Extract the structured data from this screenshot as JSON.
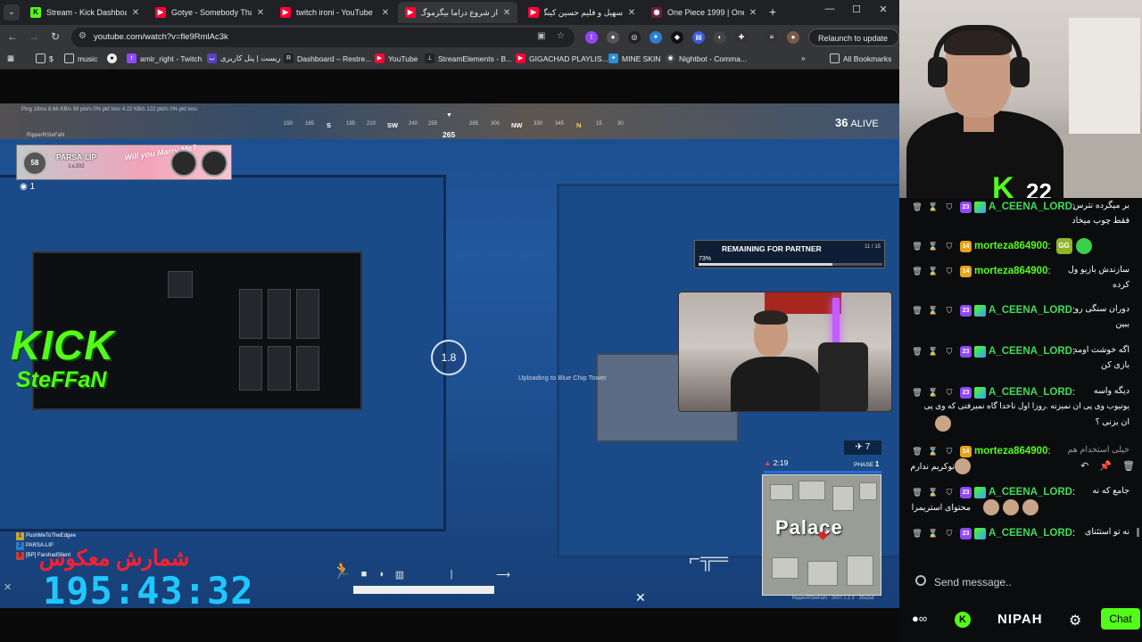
{
  "browser": {
    "tabs": [
      {
        "title": "Stream - Kick Dashboard",
        "color": "#53fc18",
        "fav": "K"
      },
      {
        "title": "Gotye - Somebody That I",
        "color": "#ff0033",
        "fav": "▶"
      },
      {
        "title": "twitch ironi - YouTube",
        "color": "#ff0033",
        "fav": "▶"
      },
      {
        "title": "از شروع دراما بیگزموگ",
        "color": "#ff0033",
        "fav": "▶"
      },
      {
        "title": "سهیل و فلیم حسین کینگ",
        "color": "#ff0033",
        "fav": "▶"
      },
      {
        "title": "One Piece 1999 | One Pie",
        "color": "#6b2130",
        "fav": "◉"
      }
    ],
    "new_tab": "+",
    "window_controls": {
      "minimize": "—",
      "maximize": "☐",
      "close": "✕"
    },
    "url": "youtube.com/watch?v=fle9RmlAc3k",
    "relaunch_label": "Relaunch to update",
    "bookmarks": [
      {
        "label": "$",
        "icon": "folder-icon"
      },
      {
        "label": "music",
        "icon": "folder-icon"
      },
      {
        "label": "",
        "icon": "github-icon"
      },
      {
        "label": "amir_right - Twitch",
        "icon": "twitch-icon"
      },
      {
        "label": "ریست | پنل کاربری",
        "icon": "panel-icon"
      },
      {
        "label": "Dashboard – Restre...",
        "icon": "restream-icon"
      },
      {
        "label": "YouTube",
        "icon": "youtube-icon"
      },
      {
        "label": "StreamElements - B...",
        "icon": "streamelements-icon"
      },
      {
        "label": "GIGACHAD PLAYLIS...",
        "icon": "youtube-icon"
      },
      {
        "label": "MINE SKIN",
        "icon": "mineskin-icon"
      },
      {
        "label": "Nightbot - Comma...",
        "icon": "nightbot-icon"
      }
    ],
    "more_bookmarks": "»",
    "all_bookmarks": "All Bookmarks"
  },
  "game": {
    "telemetry": "Ping 18ms    8.66 KB/s    59 pkt/s    0% pkt loss    4.22 KB/s    122 pkt/s    0% pkt loss",
    "compass": {
      "ticks": [
        "150",
        "165",
        "S",
        "195",
        "210",
        "SW",
        "240",
        "255",
        "265",
        "285",
        "300",
        "NW",
        "330",
        "345",
        "N",
        "15",
        "30"
      ],
      "heading": "265"
    },
    "alive_count": "36",
    "alive_label": "ALIVE",
    "player_tag": "RipperRSteFaN",
    "banner": {
      "name": "PARSA-LIP",
      "sub": "Lv.202",
      "level": "58",
      "tagline": "Will you Marry Me?"
    },
    "spectators": "1",
    "kick_logo": "KICK",
    "kick_name": "SteFFaN",
    "interact_timer": "1.8",
    "upload_hint": "Uploading to Blue Chip Tower",
    "partner": {
      "label": "REMAINING FOR PARTNER",
      "count": "11 / 15",
      "percent": "73%",
      "progress": 0.73
    },
    "kills": "7",
    "zone_timer": "2:19",
    "phase_label": "PHASE",
    "phase_num": "1",
    "map_label": "Palace",
    "build_info": "RipperRSteFaN · 2607.1.2.3 · 36a3af",
    "team": [
      {
        "num": "1",
        "name": "PushMeToTheEdgee"
      },
      {
        "num": "2",
        "name": "PARSA-LIP"
      },
      {
        "num": "3",
        "name": "[BP] FarshadSilent"
      }
    ],
    "minimap_marker": "[BP] FarshadSilent",
    "countdown_title": "شمارش معکوس",
    "countdown": "195:43:32"
  },
  "chat": {
    "kick_count": "22",
    "messages": [
      {
        "user": "A_CEENA_LORD",
        "level": "23",
        "lvl_color": "#9147ff",
        "text": "بر میگرده نترس",
        "text2": "فقط چوب میخاد"
      },
      {
        "user": "morteza864900",
        "level": "14",
        "lvl_color": "#e8a317",
        "text": "",
        "text2": "",
        "emotes": [
          "GG",
          ""
        ]
      },
      {
        "user": "morteza864900",
        "level": "14",
        "lvl_color": "#e8a317",
        "text": "سازندش بازیو ول",
        "text2": "کرده"
      },
      {
        "user": "A_CEENA_LORD",
        "level": "23",
        "lvl_color": "#9147ff",
        "text": "دوران سنگی رو",
        "text2": "ببین"
      },
      {
        "user": "A_CEENA_LORD",
        "level": "23",
        "lvl_color": "#9147ff",
        "text": "اگه خوشت اومد",
        "text2": "بازی کن"
      },
      {
        "user": "A_CEENA_LORD",
        "level": "23",
        "lvl_color": "#9147ff",
        "text": "دیگه واسه",
        "text2": "یوتیوب وی پی ان نمیزنه .روزا اول ناخدا گاه نمیرفتی که وی پی",
        "text3": "ان بزنی ؟"
      },
      {
        "user": "morteza864900",
        "level": "14",
        "lvl_color": "#e8a317",
        "text": "خیلی استخدام هم",
        "text2": "نوکریم ندارم"
      },
      {
        "user": "A_CEENA_LORD",
        "level": "23",
        "lvl_color": "#9147ff",
        "text": "جامع که نه",
        "text2": "محتوای استریمرا"
      },
      {
        "user": "A_CEENA_LORD",
        "level": "23",
        "lvl_color": "#9147ff",
        "text": "نه تو استثنای",
        "text2": ""
      }
    ],
    "hover_actions": [
      "reply-icon",
      "pin-icon",
      "delete-icon"
    ],
    "send_placeholder": "Send message..",
    "bottom": {
      "nipah": "NIPAH",
      "chat_button": "Chat"
    }
  }
}
